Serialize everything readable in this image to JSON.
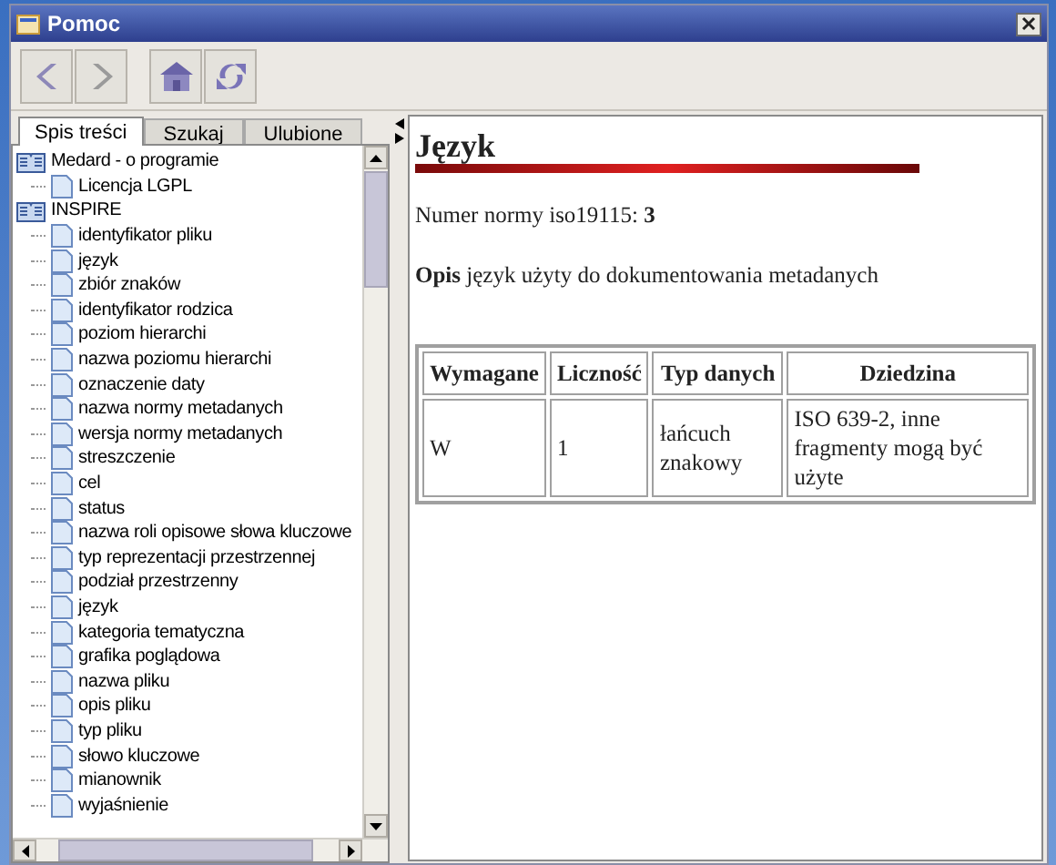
{
  "window": {
    "title": "Pomoc"
  },
  "tabs": [
    {
      "label": "Spis treści",
      "selected": true
    },
    {
      "label": "Szukaj",
      "selected": false
    },
    {
      "label": "Ulubione",
      "selected": false
    }
  ],
  "tree": [
    {
      "label": "Medard - o programie",
      "children": [
        {
          "label": "Licencja LGPL"
        }
      ]
    },
    {
      "label": "INSPIRE",
      "children": [
        {
          "label": "identyfikator pliku"
        },
        {
          "label": "język"
        },
        {
          "label": "zbiór znaków"
        },
        {
          "label": "identyfikator rodzica"
        },
        {
          "label": "poziom hierarchi"
        },
        {
          "label": "nazwa poziomu hierarchi"
        },
        {
          "label": "oznaczenie daty"
        },
        {
          "label": "nazwa normy metadanych"
        },
        {
          "label": "wersja normy metadanych"
        },
        {
          "label": "streszczenie"
        },
        {
          "label": "cel"
        },
        {
          "label": "status"
        },
        {
          "label": "nazwa roli opisowe słowa kluczowe"
        },
        {
          "label": "typ reprezentacji przestrzennej"
        },
        {
          "label": "podział przestrzenny"
        },
        {
          "label": "język"
        },
        {
          "label": "kategoria tematyczna"
        },
        {
          "label": "grafika poglądowa"
        },
        {
          "label": "nazwa pliku"
        },
        {
          "label": "opis pliku"
        },
        {
          "label": "typ pliku"
        },
        {
          "label": "słowo kluczowe"
        },
        {
          "label": "mianownik"
        },
        {
          "label": "wyjaśnienie"
        }
      ]
    }
  ],
  "page": {
    "heading": "Język",
    "norm": "Numer normy iso19115: **3**",
    "description": "**Opis** język użyty do dokumentowania metadanych",
    "table": {
      "columns": [
        "Wymagane",
        "Liczność",
        "Typ danych",
        "Dziedzina"
      ],
      "rows": [
        [
          "W",
          "1",
          "łańcuch znakowy",
          "ISO 639-2, inne fragmenty mogą być użyte"
        ]
      ]
    }
  }
}
